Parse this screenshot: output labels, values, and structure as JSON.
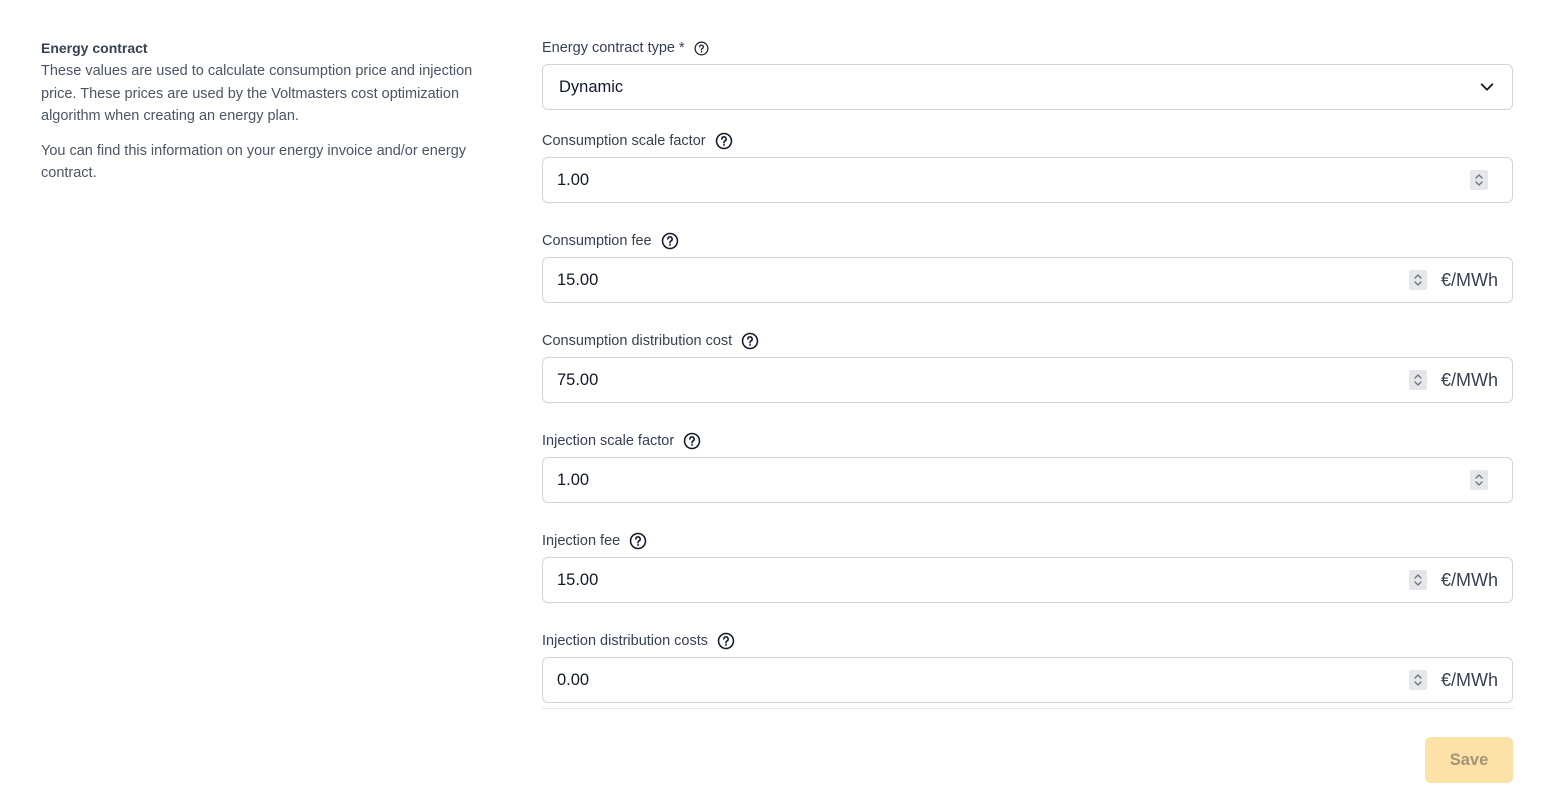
{
  "info": {
    "title": "Energy contract",
    "description_1": "These values are used to calculate consumption price and injection price. These prices are used by the Voltmasters cost optimization algorithm when creating an energy plan.",
    "description_2": "You can find this information on your energy invoice and/or energy contract."
  },
  "contract_type": {
    "label": "Energy contract type *",
    "value": "Dynamic",
    "icon": "chevron-down-icon"
  },
  "fields": [
    {
      "label": "Consumption scale factor",
      "value": "1.00",
      "unit": ""
    },
    {
      "label": "Consumption fee",
      "value": "15.00",
      "unit": "€/MWh"
    },
    {
      "label": "Consumption distribution cost",
      "value": "75.00",
      "unit": "€/MWh"
    },
    {
      "label": "Injection scale factor",
      "value": "1.00",
      "unit": ""
    },
    {
      "label": "Injection fee",
      "value": "15.00",
      "unit": "€/MWh"
    },
    {
      "label": "Injection distribution costs",
      "value": "0.00",
      "unit": "€/MWh"
    }
  ],
  "actions": {
    "save_label": "Save"
  },
  "colors": {
    "save_bg": "#fde2a7",
    "border": "#d1d5db"
  }
}
